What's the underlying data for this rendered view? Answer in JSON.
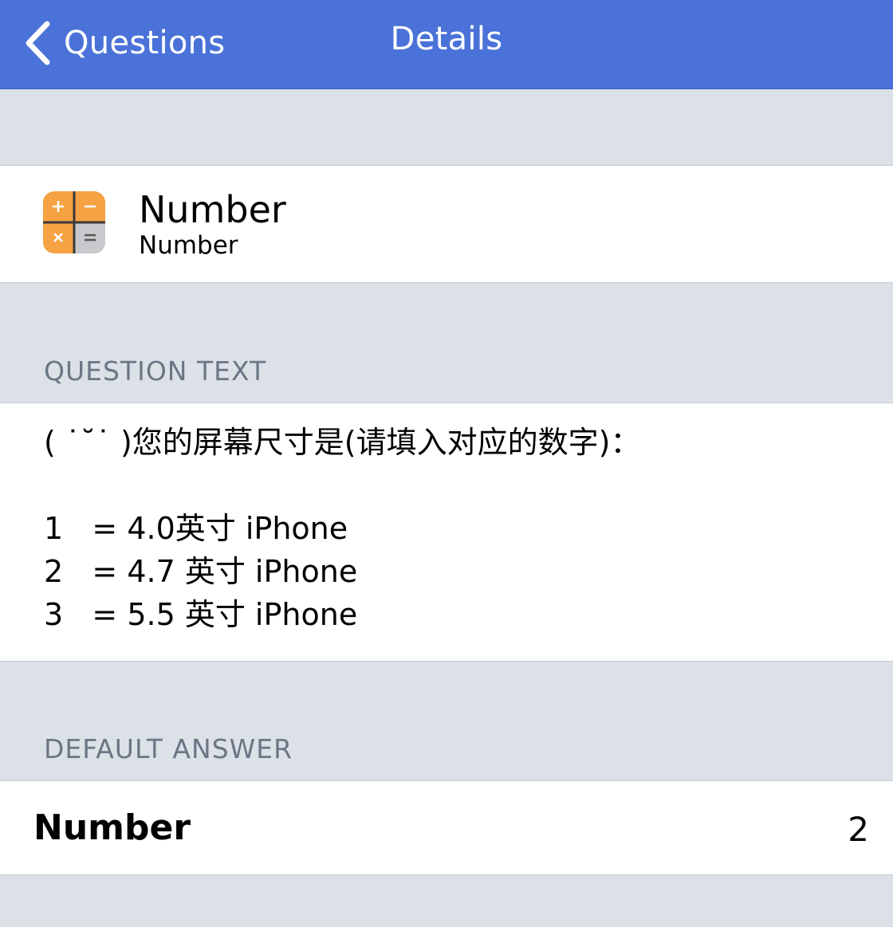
{
  "navbar": {
    "back_label": "Questions",
    "title": "Details",
    "background_color": "#4a72d8"
  },
  "question_type": {
    "icon": "calculator-icon",
    "title": "Number",
    "subtitle": "Number"
  },
  "question_text": {
    "header": "QUESTION TEXT",
    "body": "( ˙˘˙ )您的屏幕尺寸是(请填入对应的数字)：\n\n1   = 4.0英寸 iPhone\n2   = 4.7 英寸 iPhone\n3   = 5.5 英寸 iPhone"
  },
  "default_answer": {
    "header": "DEFAULT ANSWER",
    "label": "Number",
    "value": "2"
  }
}
